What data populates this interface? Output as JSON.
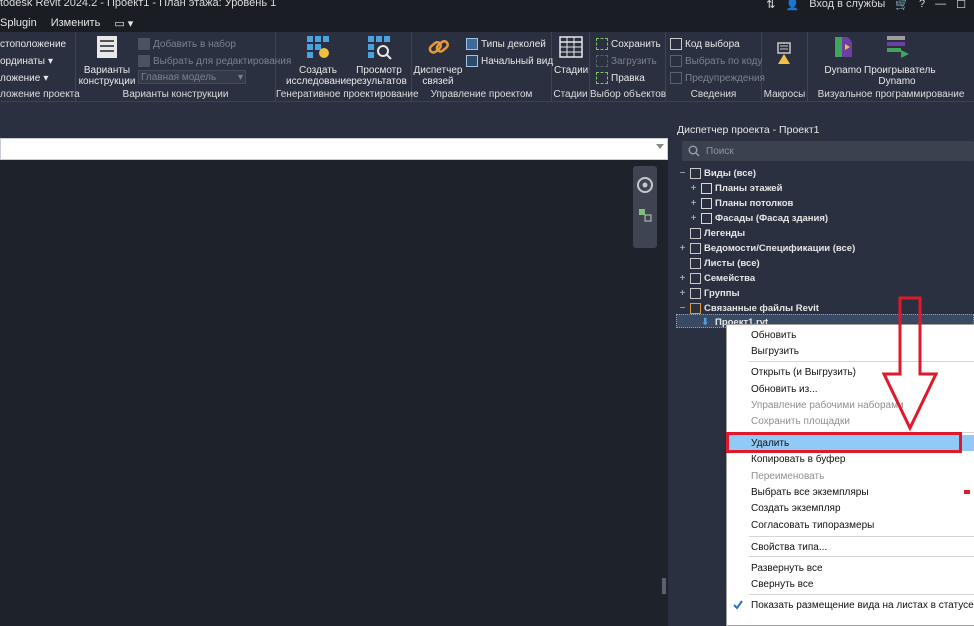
{
  "window": {
    "title": "todesk Revit 2024.2 - Проект1 - План этажа: Уровень 1",
    "signin": "Вход в службы",
    "help": "?"
  },
  "menu": [
    "Splugin",
    "Изменить"
  ],
  "ribbon": {
    "left_items": [
      "стоположение",
      "ординаты",
      "ложение"
    ],
    "panels": {
      "location_title": "ложение проекта",
      "design_options": {
        "title": "Варианты конструкции",
        "main_label": "Варианты\nконструкции",
        "add_to_set": "Добавить в набор",
        "pick_to_edit": "Выбрать для редактирования",
        "main_model": "Главная модель"
      },
      "generative": {
        "title": "Генеративное проектирование",
        "create_study": "Создать\nисследование",
        "explore_results": "Просмотр\nрезультатов"
      },
      "manage_project": {
        "title": "Управление проектом",
        "manage_links": "Диспетчер\nсвязей",
        "decal_types": "Типы деколей",
        "starting_view": "Начальный вид"
      },
      "phasing": {
        "title": "Стадии",
        "phases": "Стадии"
      },
      "selection": {
        "title": "Выбор объектов",
        "save": "Сохранить",
        "load": "Загрузить",
        "edit": "Правка"
      },
      "inquiry": {
        "title": "Сведения",
        "select_by_id": "Код выбора",
        "ids_of_selection": "Выбрать по коду",
        "warnings": "Предупреждения"
      },
      "macros": {
        "title": "Макросы"
      },
      "visual_programming": {
        "title": "Визуальное программирование",
        "dynamo": "Dynamo",
        "dynamo_player": "Проигрыватель\nDynamo"
      }
    }
  },
  "browser": {
    "title": "Диспетчер проекта - Проект1",
    "search_placeholder": "Поиск",
    "tree": [
      {
        "label": "Виды (все)",
        "pm": "−",
        "indent": 0
      },
      {
        "label": "Планы этажей",
        "pm": "+",
        "indent": 1
      },
      {
        "label": "Планы потолков",
        "pm": "+",
        "indent": 1
      },
      {
        "label": "Фасады (Фасад здания)",
        "pm": "+",
        "indent": 1
      },
      {
        "label": "Легенды",
        "pm": "",
        "indent": 0
      },
      {
        "label": "Ведомости/Спецификации (все)",
        "pm": "+",
        "indent": 0
      },
      {
        "label": "Листы (все)",
        "pm": "",
        "indent": 0
      },
      {
        "label": "Семейства",
        "pm": "+",
        "indent": 0
      },
      {
        "label": "Группы",
        "pm": "+",
        "indent": 0
      },
      {
        "label": "Связанные файлы Revit",
        "pm": "−",
        "indent": 0
      },
      {
        "label": "Проект1.rvt",
        "pm": "",
        "indent": 1
      }
    ]
  },
  "context_menu": {
    "items": [
      {
        "label": "Обновить",
        "enabled": true
      },
      {
        "label": "Выгрузить",
        "enabled": true
      },
      {
        "label": "Открыть (и Выгрузить)",
        "enabled": true
      },
      {
        "label": "Обновить из...",
        "enabled": true
      },
      {
        "label": "Управление рабочими наборами",
        "enabled": false
      },
      {
        "label": "Сохранить площадки",
        "enabled": false
      },
      {
        "label": "Удалить",
        "enabled": true,
        "highlighted": true
      },
      {
        "label": "Копировать в буфер",
        "enabled": true
      },
      {
        "label": "Переименовать",
        "enabled": false
      },
      {
        "label": "Выбрать все экземпляры",
        "enabled": true
      },
      {
        "label": "Создать экземпляр",
        "enabled": true
      },
      {
        "label": "Согласовать типоразмеры",
        "enabled": true
      },
      {
        "label": "Свойства типа...",
        "enabled": true
      },
      {
        "label": "Развернуть все",
        "enabled": true
      },
      {
        "label": "Свернуть все",
        "enabled": true
      },
      {
        "label": "Показать размещение вида на листах в статусе",
        "enabled": true,
        "checked": true
      }
    ]
  },
  "colors": {
    "highlight": "#91c9f7",
    "annotation": "#e0182b",
    "ribbon_bg": "#2b3040",
    "canvas_bg": "#1e222b"
  }
}
